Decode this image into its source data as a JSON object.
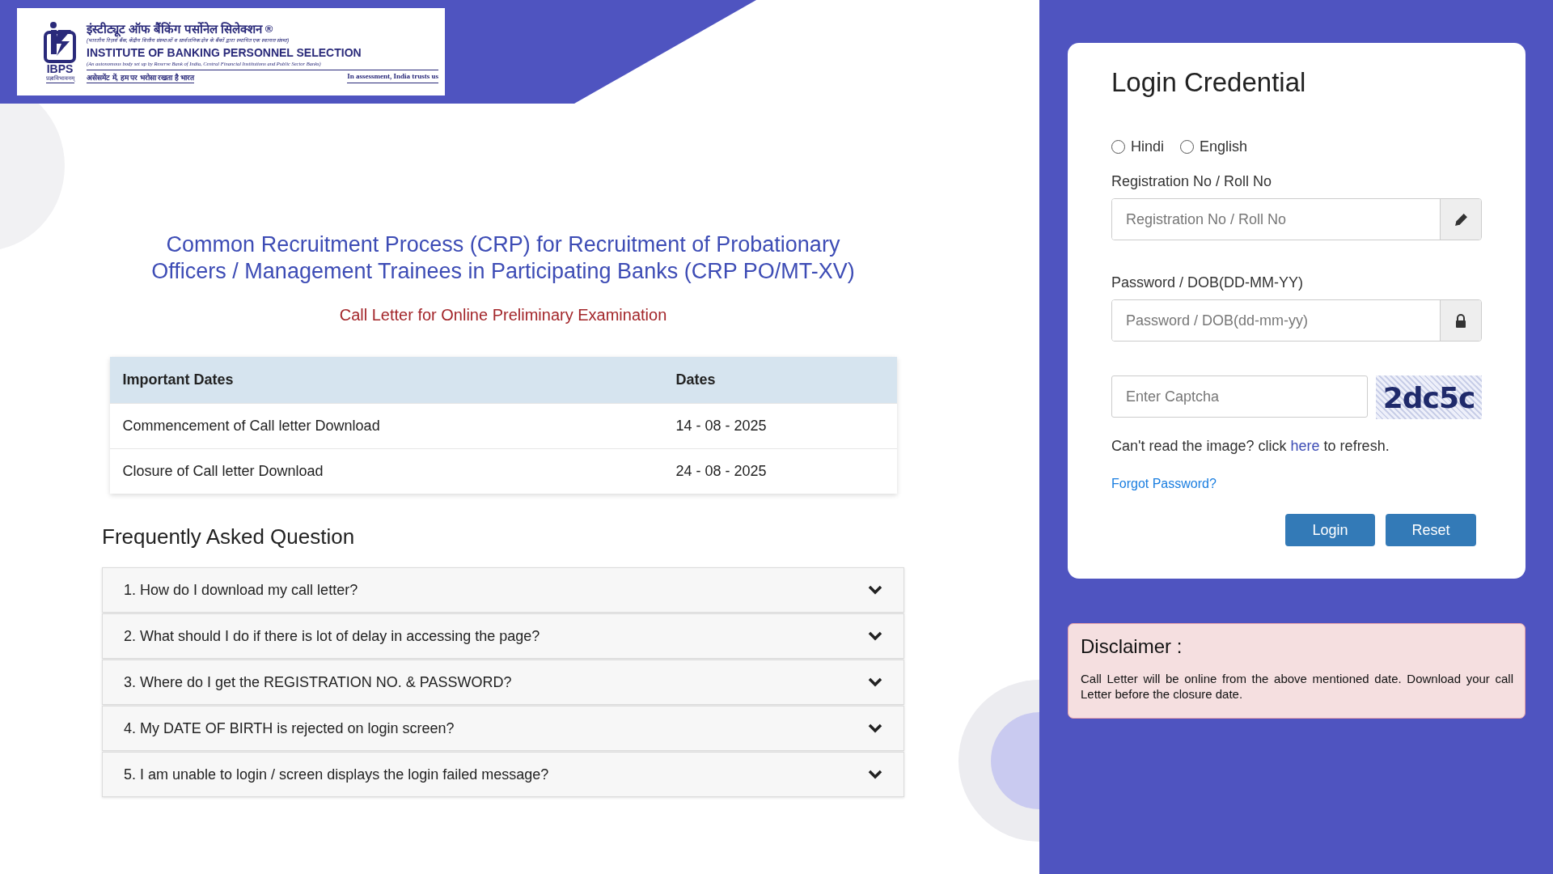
{
  "logo": {
    "emblem_text": "IBPS",
    "motto": "प्रज्ञाविभावनम्",
    "hindi_name": "इंस्टीट्यूट ऑफ बैंकिंग पर्सोनेल सिलेक्शन",
    "registered": "®",
    "hindi_note": "(भारतीय रिज़र्व बैंक, केंद्रीय वित्तीय संस्थाओं व सार्वजनिक क्षेत्र के बैंकों द्वारा स्थापित एक स्वायत्त संस्था)",
    "english_name": "INSTITUTE OF BANKING PERSONNEL SELECTION",
    "english_note": "(An autonomous body set up by Reserve Bank of India, Central Financial Institutions and Public Sector Banks)",
    "hindi_tagline": "असेसमेंट में, हम पर भरोसा रखता है भारत",
    "english_tagline": "In assessment, India trusts us"
  },
  "title": "Common Recruitment Process (CRP) for Recruitment of Probationary Officers / Management Trainees in Participating Banks (CRP PO/MT-XV)",
  "subtitle": "Call Letter for Online Preliminary Examination",
  "dates_table": {
    "columns": [
      "Important Dates",
      "Dates"
    ],
    "rows": [
      [
        "Commencement of Call letter Download",
        "14 - 08 - 2025"
      ],
      [
        "Closure of Call letter Download",
        "24 - 08 - 2025"
      ]
    ]
  },
  "faq": {
    "heading": "Frequently Asked Question",
    "items": [
      {
        "question": "1. How do I download my call letter?",
        "expanded": false
      },
      {
        "question": "2. What should I do if there is lot of delay in accessing the page?",
        "expanded": false
      },
      {
        "question": "3. Where do I get the REGISTRATION NO. & PASSWORD?",
        "expanded": false
      },
      {
        "question": "4. My DATE OF BIRTH is rejected on login screen?",
        "expanded": false
      },
      {
        "question": "5. I am unable to login / screen displays the login failed message?",
        "expanded": false
      }
    ]
  },
  "login": {
    "title": "Login Credential",
    "languages": [
      {
        "label": "Hindi",
        "selected": false
      },
      {
        "label": "English",
        "selected": false
      }
    ],
    "registration": {
      "label": "Registration No / Roll No",
      "placeholder": "Registration No / Roll No"
    },
    "password": {
      "label": "Password / DOB(DD-MM-YY)",
      "placeholder": "Password / DOB(dd-mm-yy)"
    },
    "captcha": {
      "placeholder": "Enter Captcha",
      "image_text": "2dc5c"
    },
    "refresh": {
      "before": "Can't read the image? click",
      "link": "here",
      "after": "to refresh."
    },
    "forgot": "Forgot Password?",
    "buttons": [
      "Login",
      "Reset"
    ]
  },
  "disclaimer": {
    "title": "Disclaimer :",
    "text": "Call Letter will be online from the above mentioned date. Download your call Letter before the closure date."
  }
}
